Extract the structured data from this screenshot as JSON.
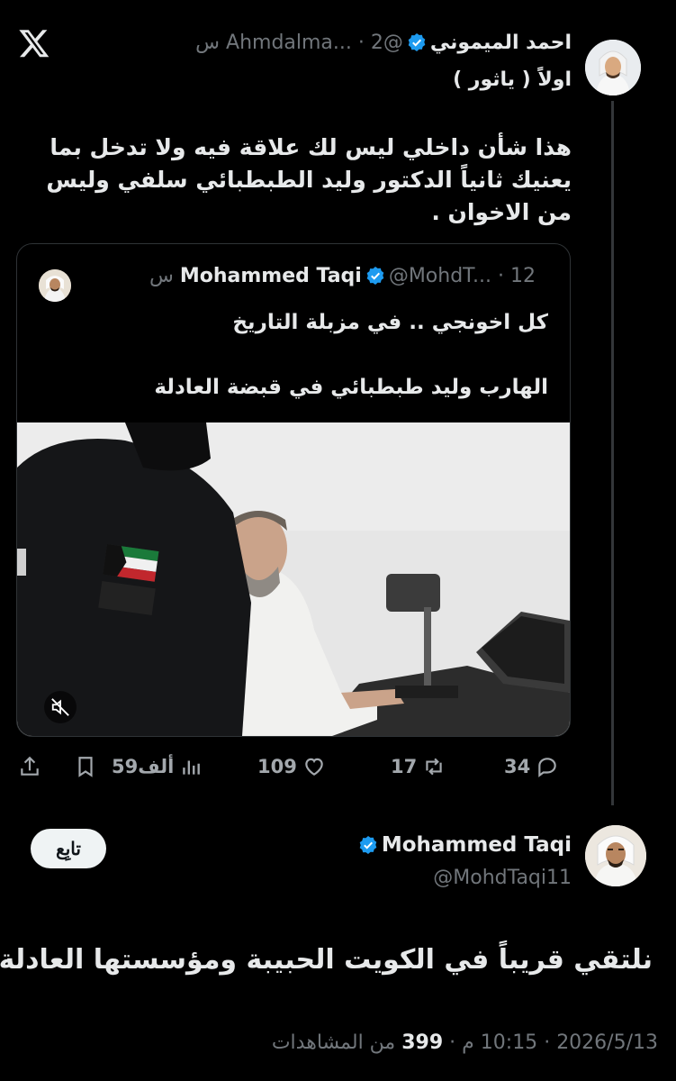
{
  "colors": {
    "background": "#000000",
    "text": "#e7e9ea",
    "muted": "#71767b",
    "verified": "#1d9bf0",
    "follow_bg": "#eff3f4"
  },
  "header": {
    "logo_icon": "x-logo-icon"
  },
  "reply": {
    "name": "احمد الميموني",
    "handle": "@Ahmdalma...",
    "sep": "·",
    "time": "2 س",
    "first_line": "اولاً ( ياثور )",
    "body": "هذا شأن داخلي ليس لك علاقة فيه ولا تدخل بما يعنيك ثانياً الدكتور وليد الطبطبائي سلفي وليس من الاخوان ."
  },
  "quote": {
    "name": "Mohammed Taqi",
    "handle": "@MohdT...",
    "sep": "·",
    "time": "12 س",
    "line1": "كل اخونجي .. في مزبلة التاريخ",
    "line2": "الهارب وليد طبطبائي في قبضة العادلة",
    "media_icon": "mute-icon"
  },
  "actions": {
    "replies": "34",
    "reposts": "17",
    "likes": "109",
    "views": "59ألف"
  },
  "author": {
    "name": "Mohammed Taqi",
    "handle": "@MohdTaqi11",
    "follow_label": "تابِع"
  },
  "post": {
    "text": "نلتقي قريباً في الكويت الحبيبة ومؤسستها العادلة",
    "date": "2026/5/13",
    "time": "10:15 م",
    "sep": "·",
    "views": "399",
    "views_label": "من المشاهدات"
  }
}
